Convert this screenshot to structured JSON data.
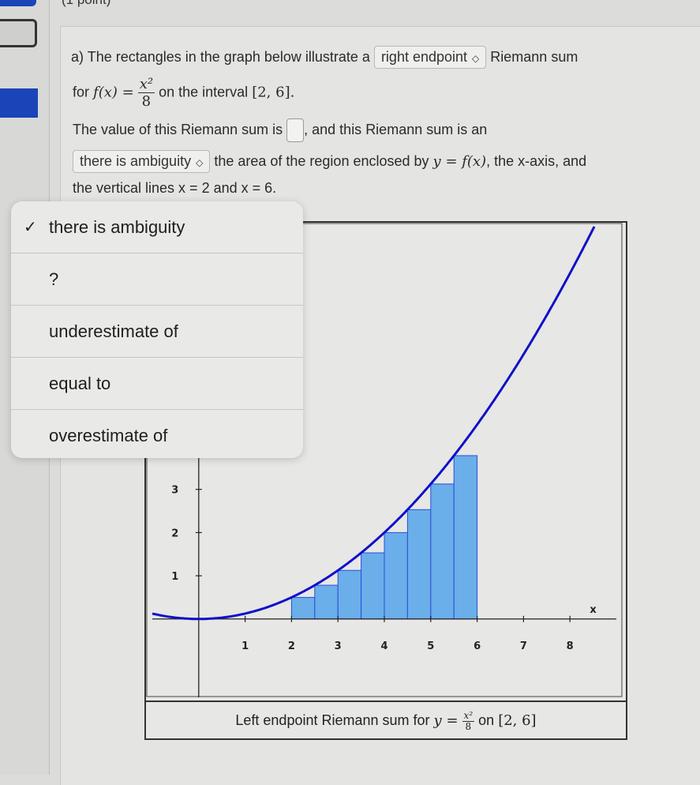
{
  "header": {
    "points_fragment": "(1 point)"
  },
  "question": {
    "part_label": "a)",
    "line1_prefix": "The rectangles in the graph below illustrate a",
    "endpoint_select_value": "right endpoint",
    "line1_suffix": "Riemann sum",
    "line2_for": "for",
    "function_lhs": "f(x) =",
    "function_num": "x²",
    "function_den": "8",
    "line2_mid": "on the interval",
    "interval": "[2, 6].",
    "line3_prefix": "The value of this Riemann sum is",
    "line3_suffix": ", and this Riemann sum is an",
    "answer_value": "",
    "comparison_select_value": "there is ambiguity",
    "line4_suffix_a": "the area of the region enclosed by",
    "line4_math": "y = f(x)",
    "line4_suffix_b": ", the x-axis, and",
    "line5": "the vertical lines x = 2 and x = 6."
  },
  "dropdown": {
    "selected_index": 0,
    "options": [
      "there is ambiguity",
      "?",
      "underestimate of",
      "equal to",
      "overestimate of"
    ],
    "check_glyph": "✓"
  },
  "caption": {
    "prefix": "Left endpoint Riemann sum for",
    "math_lhs": "y =",
    "num": "x²",
    "den": "8",
    "suffix": "on",
    "interval": "[2, 6]"
  },
  "chart_data": {
    "type": "bar",
    "title": "Left endpoint Riemann sum for y = x^2/8 on [2, 6]",
    "function": "y = x^2/8",
    "interval": [
      2,
      6
    ],
    "n_subintervals": 8,
    "method": "left endpoint",
    "rectangles": [
      {
        "x_left": 2.0,
        "x_right": 2.5,
        "height": 0.5
      },
      {
        "x_left": 2.5,
        "x_right": 3.0,
        "height": 0.78125
      },
      {
        "x_left": 3.0,
        "x_right": 3.5,
        "height": 1.125
      },
      {
        "x_left": 3.5,
        "x_right": 4.0,
        "height": 1.53125
      },
      {
        "x_left": 4.0,
        "x_right": 4.5,
        "height": 2.0
      },
      {
        "x_left": 4.5,
        "x_right": 5.0,
        "height": 2.53125
      },
      {
        "x_left": 5.0,
        "x_right": 5.5,
        "height": 3.125
      },
      {
        "x_left": 5.5,
        "x_right": 6.0,
        "height": 3.78125
      }
    ],
    "x_ticks": [
      1,
      2,
      3,
      4,
      5,
      6,
      7,
      8
    ],
    "y_ticks": [
      1,
      2,
      3,
      4
    ],
    "xlabel": "x",
    "ylabel": "",
    "xlim": [
      -1,
      9
    ],
    "ylim": [
      -0.9,
      9.1
    ],
    "grid": false,
    "colors": {
      "curve": "#1010c8",
      "bar_fill": "#6aaeea",
      "bar_stroke": "#2a4fd8"
    }
  }
}
